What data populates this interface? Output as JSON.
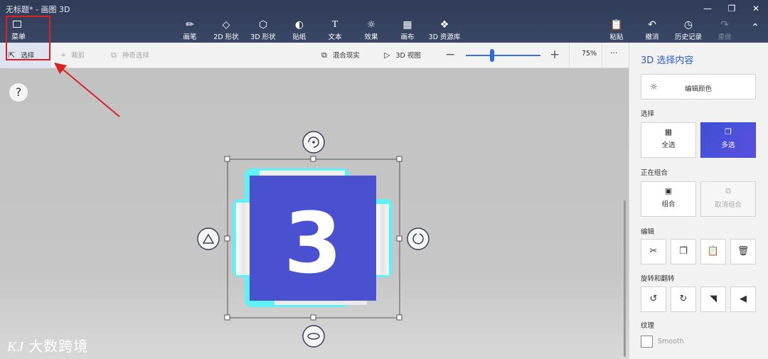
{
  "window": {
    "title": "无标题* - 画图 3D",
    "minimize_icon": "minimize-icon",
    "restore_icon": "restore-icon",
    "close_icon": "close-icon"
  },
  "menu": {
    "label": "菜单",
    "icon": "folder-icon"
  },
  "ribbon": {
    "tools": [
      {
        "label": "画笔",
        "icon": "brush-icon"
      },
      {
        "label": "2D 形状",
        "icon": "2d-shapes-icon"
      },
      {
        "label": "3D 形状",
        "icon": "3d-shapes-icon"
      },
      {
        "label": "贴纸",
        "icon": "sticker-icon"
      },
      {
        "label": "文本",
        "icon": "text-icon"
      },
      {
        "label": "效果",
        "icon": "effects-icon"
      },
      {
        "label": "画布",
        "icon": "canvas-icon"
      },
      {
        "label": "3D 资源库",
        "icon": "3d-library-icon"
      }
    ],
    "right_tools": [
      {
        "label": "粘贴",
        "icon": "paste-icon"
      },
      {
        "label": "撤消",
        "icon": "undo-icon"
      },
      {
        "label": "历史记录",
        "icon": "history-icon"
      },
      {
        "label": "重做",
        "icon": "redo-icon"
      }
    ],
    "collapse_icon": "chevron-up-icon"
  },
  "subtoolbar": {
    "select": "选择",
    "crop": "裁剪",
    "magic_select": "神奇选择",
    "mixed_reality": "混合现实",
    "view_3d": "3D 视图",
    "zoom_level": "75%",
    "zoom_fraction": 0.35,
    "more": "···"
  },
  "canvas": {
    "help": "?",
    "object_number": "3",
    "watermark": "大数跨境",
    "watermark_logo": "KJ"
  },
  "panel": {
    "title": "3D 选择内容",
    "edit_color": "编辑颜色",
    "select_section": "选择",
    "select_all": "全选",
    "multi_select": "多选",
    "group_section": "正在组合",
    "group": "组合",
    "ungroup": "取消组合",
    "edit_section": "编辑",
    "rotate_section": "旋转和翻转",
    "texture_section": "纹理",
    "smooth": "Smooth"
  },
  "colors": {
    "accent": "#2d5fc4",
    "object_face": "#4a51d1",
    "selection_glow": "#5ef2f8",
    "annotation": "#e02020"
  }
}
